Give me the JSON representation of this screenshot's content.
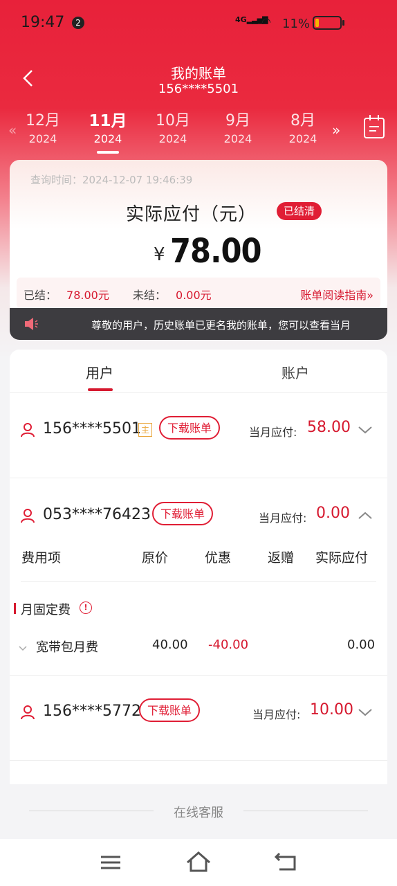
{
  "status": {
    "time": "19:47",
    "notif_count": "2",
    "network": "4G",
    "battery": "11%"
  },
  "header": {
    "title": "我的账单",
    "subtitle": "156****5501"
  },
  "months": [
    {
      "m": "12月",
      "y": "2024"
    },
    {
      "m": "11月",
      "y": "2024"
    },
    {
      "m": "10月",
      "y": "2024"
    },
    {
      "m": "9月",
      "y": "2024"
    },
    {
      "m": "8月",
      "y": "2024"
    }
  ],
  "summary": {
    "query_time": "查询时间：2024-12-07 19:46:39",
    "pay_label": "实际应付（元）",
    "settled_badge": "已结清",
    "currency": "¥",
    "amount": "78.00",
    "settled_label": "已结：",
    "settled_value": "78.00元",
    "unsettled_label": "未结：",
    "unsettled_value": "0.00元",
    "guide": "账单阅读指南"
  },
  "notice": {
    "text": "尊敬的用户，历史账单已更名我的账单，您可以查看当月"
  },
  "tabs": {
    "user": "用户",
    "account": "账户"
  },
  "accounts": [
    {
      "phone": "156****5501",
      "primary": "主",
      "download": "下载账单",
      "due_label": "当月应付:",
      "due": "58.00"
    },
    {
      "phone": "053****76423",
      "download": "下载账单",
      "due_label": "当月应付:",
      "due": "0.00"
    },
    {
      "phone": "156****5772",
      "download": "下载账单",
      "due_label": "当月应付:",
      "due": "10.00"
    }
  ],
  "fee_table": {
    "headers": [
      "费用项",
      "原价",
      "优惠",
      "返赠",
      "实际应付"
    ],
    "section": "月固定费",
    "rows": [
      {
        "item": "宽带包月费",
        "original": "40.00",
        "discount": "-40.00",
        "gift": "",
        "actual": "0.00"
      }
    ]
  },
  "footer": {
    "online_service": "在线客服"
  },
  "colors": {
    "brand_red": "#e01e35",
    "price_red": "#d6192f"
  }
}
